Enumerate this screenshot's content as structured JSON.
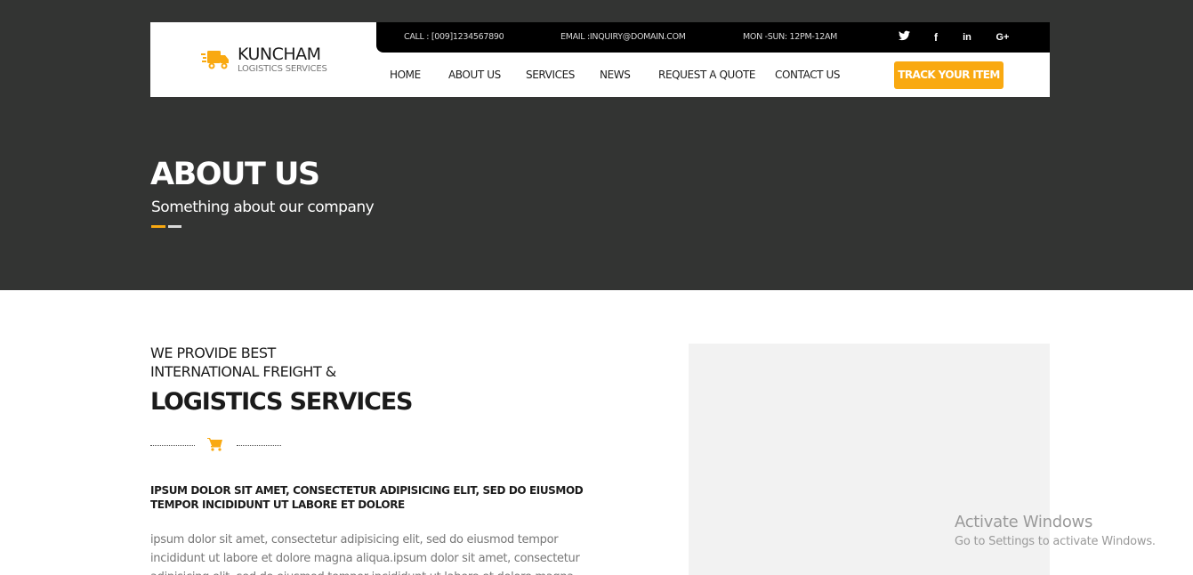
{
  "brand": {
    "name": "KUNCHAM",
    "tagline": "LOGISTICS SERVICES"
  },
  "topbar": {
    "call": "CALL : [009]1234567890",
    "email": "EMAIL :INQUIRY@DOMAIN.COM",
    "hours": "MON -SUN: 12PM-12AM",
    "social": [
      {
        "name": "twitter-icon",
        "glyph": "🐦"
      },
      {
        "name": "facebook-icon",
        "glyph": "f"
      },
      {
        "name": "linkedin-icon",
        "glyph": "in"
      },
      {
        "name": "google-plus-icon",
        "glyph": "G+"
      }
    ]
  },
  "nav": {
    "items": [
      "HOME",
      "ABOUT US",
      "SERVICES",
      "NEWS",
      "REQUEST A QUOTE",
      "CONTACT US"
    ],
    "cta": "TRACK YOUR ITEM"
  },
  "hero": {
    "title": "ABOUT US",
    "subtitle": "Something about our company"
  },
  "intro": {
    "line1": "WE PROVIDE BEST",
    "line2": "INTERNATIONAL FREIGHT &",
    "line3": "LOGISTICS SERVICES",
    "bold_text": "IPSUM DOLOR SIT AMET, CONSECTETUR ADIPISICING ELIT, SED DO EIUSMOD TEMPOR INCIDIDUNT UT LABORE ET DOLORE",
    "body_text": "ipsum dolor sit amet, consectetur adipisicing elit, sed do eiusmod tempor incididunt ut labore et dolore magna aliqua.ipsum dolor sit amet, consectetur adipisicing elit, sed do eiusmod tempor incididunt ut labore et dolore magna aliqua."
  },
  "watermark": {
    "title": "Activate Windows",
    "subtitle": "Go to Settings to activate Windows."
  },
  "colors": {
    "accent": "#f9a911",
    "dark": "#333433",
    "topbar": "#000000"
  }
}
